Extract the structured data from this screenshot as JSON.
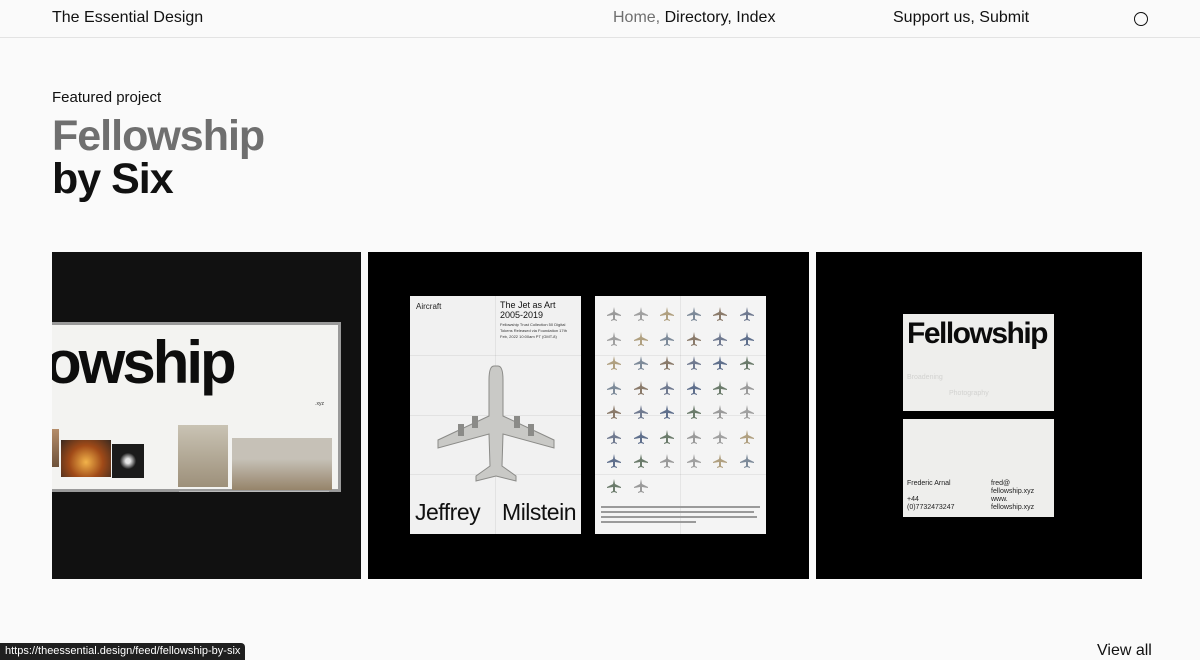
{
  "header": {
    "brand": "The Essential Design",
    "nav": {
      "home": "Home,",
      "directory": "Directory,",
      "index": "Index"
    },
    "secondary": {
      "support": "Support us,",
      "submit": "Submit"
    },
    "menu_icon": "circle-menu-icon"
  },
  "featured": {
    "eyebrow": "Featured project",
    "title_line1": "Fellowship",
    "title_line2": "by Six"
  },
  "gallery": {
    "image1": {
      "billboard_word": "owship",
      "billboard_tld": ".xyz"
    },
    "image2": {
      "poster_label": "Aircraft",
      "poster_title_l1": "The Jet as Art",
      "poster_title_l2": "2005-2019",
      "poster_meta": "Fellowship Trust Collection 50 Digital Tokens Released via Foundation 17th Feb, 2022 10:00am PT (GMT-8)",
      "poster_first": "Jeffrey",
      "poster_last": "Milstein"
    },
    "image3": {
      "card_word": "Fellowship",
      "card_faint1": "Broadening",
      "card_faint2": "Photography",
      "card_name": "Frederic Arnal",
      "card_phone_l1": "+44",
      "card_phone_l2": "(0)7732473247",
      "card_email_l1": "fred@",
      "card_email_l2": "fellowship.xyz",
      "card_web_l1": "www.",
      "card_web_l2": "fellowship.xyz"
    }
  },
  "footer": {
    "status_url": "https://theessential.design/feed/fellowship-by-six",
    "view_all": "View all"
  },
  "colors": {
    "background": "#fafafa",
    "text": "#111111",
    "muted": "#6f6f6f",
    "image_bg": "#000000"
  }
}
